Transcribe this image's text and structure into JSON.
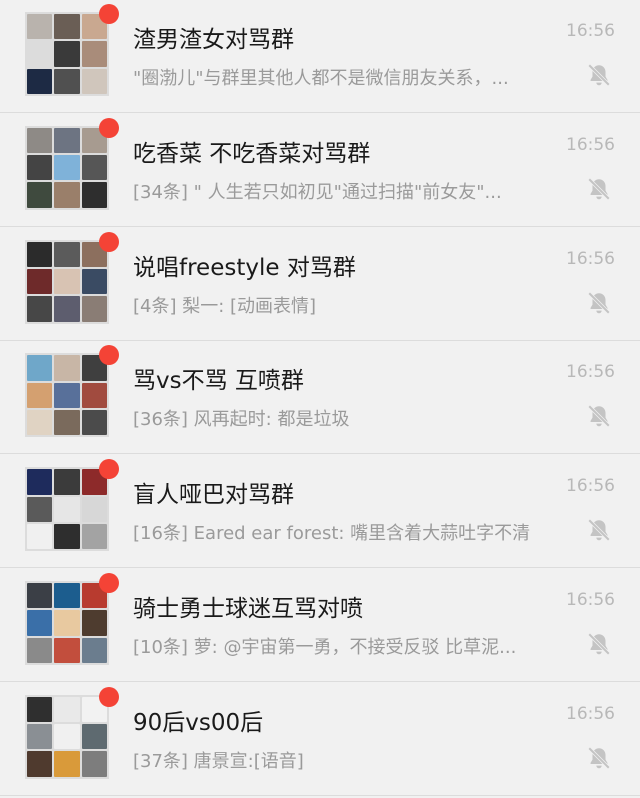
{
  "chats": [
    {
      "title": "渣男渣女对骂群",
      "preview": "\"圈渤儿\"与群里其他人都不是微信朋友关系，...",
      "time": "16:56",
      "unread": true,
      "muted": true,
      "avatar_colors": [
        "#b9b3ad",
        "#6a5e55",
        "#c9a890",
        "#dcdcdc",
        "#3a3a3a",
        "#a98c7a",
        "#1d2a44",
        "#505050",
        "#d0c6bc"
      ]
    },
    {
      "title": "吃香菜 不吃香菜对骂群",
      "preview": "[34条] \" 人生若只如初见\"通过扫描\"前女友\"...",
      "time": "16:56",
      "unread": true,
      "muted": true,
      "avatar_colors": [
        "#8e8a86",
        "#6d7482",
        "#a79b90",
        "#444444",
        "#7fb2d9",
        "#565656",
        "#3f4a3e",
        "#9a7f6a",
        "#2e2e2e"
      ]
    },
    {
      "title": "说唱freestyle 对骂群",
      "preview": "[4条] 梨一: [动画表情]",
      "time": "16:56",
      "unread": true,
      "muted": true,
      "avatar_colors": [
        "#2b2b2b",
        "#5b5b5b",
        "#8c6f5e",
        "#6e2a2a",
        "#d8c3b3",
        "#3a4b63",
        "#474747",
        "#5d5d6e",
        "#8a7d75"
      ]
    },
    {
      "title": "骂vs不骂 互喷群",
      "preview": "[36条] 风再起时: 都是垃圾",
      "time": "16:56",
      "unread": true,
      "muted": true,
      "avatar_colors": [
        "#6fa7c9",
        "#c8b6a6",
        "#3f3f3f",
        "#d4a070",
        "#58709a",
        "#a14b3f",
        "#e0d3c3",
        "#7a6a5c",
        "#4b4b4b"
      ]
    },
    {
      "title": "盲人哑巴对骂群",
      "preview": "[16条] Eared ear forest: 嘴里含着大蒜吐字不清",
      "time": "16:56",
      "unread": true,
      "muted": true,
      "avatar_colors": [
        "#1e2b5c",
        "#3b3b3b",
        "#8d2a2a",
        "#5a5a5a",
        "#e6e6e6",
        "#d7d7d7",
        "#f0f0f0",
        "#2e2e2e",
        "#a3a3a3"
      ]
    },
    {
      "title": "骑士勇士球迷互骂对喷",
      "preview": "[10条] 萝: @宇宙第一勇，不接受反驳 比草泥...",
      "time": "16:56",
      "unread": true,
      "muted": true,
      "avatar_colors": [
        "#3b3f46",
        "#1c5d8e",
        "#b83b2f",
        "#3a6fa8",
        "#e8c9a0",
        "#4e3c2f",
        "#8a8a8a",
        "#c24e3d",
        "#6b7d8e"
      ]
    },
    {
      "title": "90后vs00后",
      "preview": "[37条] 唐景宣:[语音]",
      "time": "16:56",
      "unread": true,
      "muted": true,
      "avatar_colors": [
        "#2f2f2f",
        "#e9e9e9",
        "#f2f2f2",
        "#8a8f94",
        "#f0f0f0",
        "#5e6a70",
        "#4f3a2e",
        "#d99a3a",
        "#7d7d7d"
      ]
    }
  ]
}
